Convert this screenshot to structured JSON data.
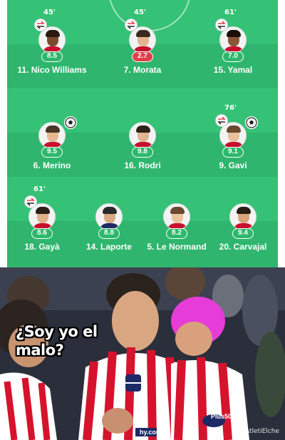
{
  "lineup": {
    "rows": [
      [
        {
          "name": "11. Nico Williams",
          "rating": "8.5",
          "minute": "45'",
          "sub": true,
          "goal": false,
          "low": false,
          "skin": "#7a4a2e",
          "hair": "#2a1a10",
          "shirt": "#c8102e"
        },
        {
          "name": "7. Morata",
          "rating": "2.7",
          "minute": "45'",
          "sub": true,
          "goal": false,
          "low": true,
          "skin": "#e2b48f",
          "hair": "#3a2a1e",
          "shirt": "#c8102e"
        },
        {
          "name": "15. Yamal",
          "rating": "7.0",
          "minute": "61'",
          "sub": true,
          "goal": false,
          "low": false,
          "skin": "#8a5636",
          "hair": "#1a1008",
          "shirt": "#c8102e"
        }
      ],
      [
        {
          "name": "6. Merino",
          "rating": "9.5",
          "minute": "",
          "sub": false,
          "goal": true,
          "low": false,
          "skin": "#e6b892",
          "hair": "#4a3626",
          "shirt": "#c8102e"
        },
        {
          "name": "16. Rodri",
          "rating": "9.8",
          "minute": "",
          "sub": false,
          "goal": false,
          "low": false,
          "skin": "#e2b490",
          "hair": "#2e2218",
          "shirt": "#c8102e"
        },
        {
          "name": "9. Gavi",
          "rating": "9.1",
          "minute": "76'",
          "sub": true,
          "goal": true,
          "low": false,
          "skin": "#e9bf9c",
          "hair": "#6a4a2e",
          "shirt": "#c8102e"
        }
      ],
      [
        {
          "name": "18. Gayà",
          "rating": "8.6",
          "minute": "61'",
          "sub": true,
          "goal": false,
          "low": false,
          "skin": "#e0b08a",
          "hair": "#2a2018",
          "shirt": "#c8102e"
        },
        {
          "name": "14. Laporte",
          "rating": "8.8",
          "minute": "",
          "sub": false,
          "goal": false,
          "low": false,
          "skin": "#d9a783",
          "hair": "#2a2a2a",
          "shirt": "#1e2a66"
        },
        {
          "name": "5. Le Normand",
          "rating": "8.2",
          "minute": "",
          "sub": false,
          "goal": false,
          "low": false,
          "skin": "#ebc4a0",
          "hair": "#6a4a30",
          "shirt": "#c8102e"
        },
        {
          "name": "20. Carvajal",
          "rating": "9.4",
          "minute": "",
          "sub": false,
          "goal": false,
          "low": false,
          "skin": "#d8a47c",
          "hair": "#2a1e14",
          "shirt": "#c8102e"
        }
      ]
    ]
  },
  "meme": {
    "caption": "¿Soy yo el malo?",
    "watermark": "#AtletiElche",
    "shirt_text": "Plus500",
    "sponsor_small": "hy.com"
  },
  "colors": {
    "pitch": "#2db86b",
    "rating_green": "#2db86b",
    "rating_red": "#e0404a",
    "kit_red": "#d6132d"
  }
}
